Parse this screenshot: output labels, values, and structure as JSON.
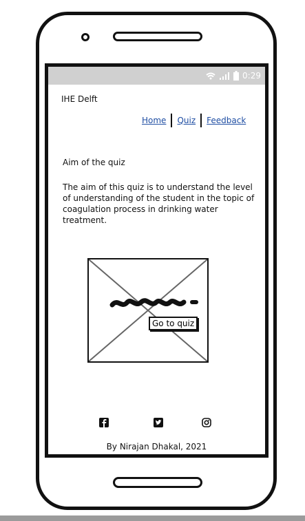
{
  "status_bar": {
    "time": "0:29",
    "icons": [
      "wifi-icon",
      "signal-icon",
      "battery-icon"
    ]
  },
  "header": {
    "brand": "IHE Delft"
  },
  "nav": {
    "items": [
      {
        "label": "Home"
      },
      {
        "label": "Quiz"
      },
      {
        "label": "Feedback"
      }
    ]
  },
  "main": {
    "title": "Aim of the quiz",
    "description": "The aim of this quiz is to understand the level of understanding of the student in the topic of coagulation process in drinking water treatment.",
    "button_label": "Go to quiz"
  },
  "social": {
    "icons": [
      "facebook-icon",
      "twitter-icon",
      "instagram-icon"
    ]
  },
  "footer": {
    "text": "By Nirajan Dhakal, 2021"
  },
  "colors": {
    "link": "#1f4ea3",
    "status_bar": "#d0d0d0",
    "outline": "#111111"
  }
}
